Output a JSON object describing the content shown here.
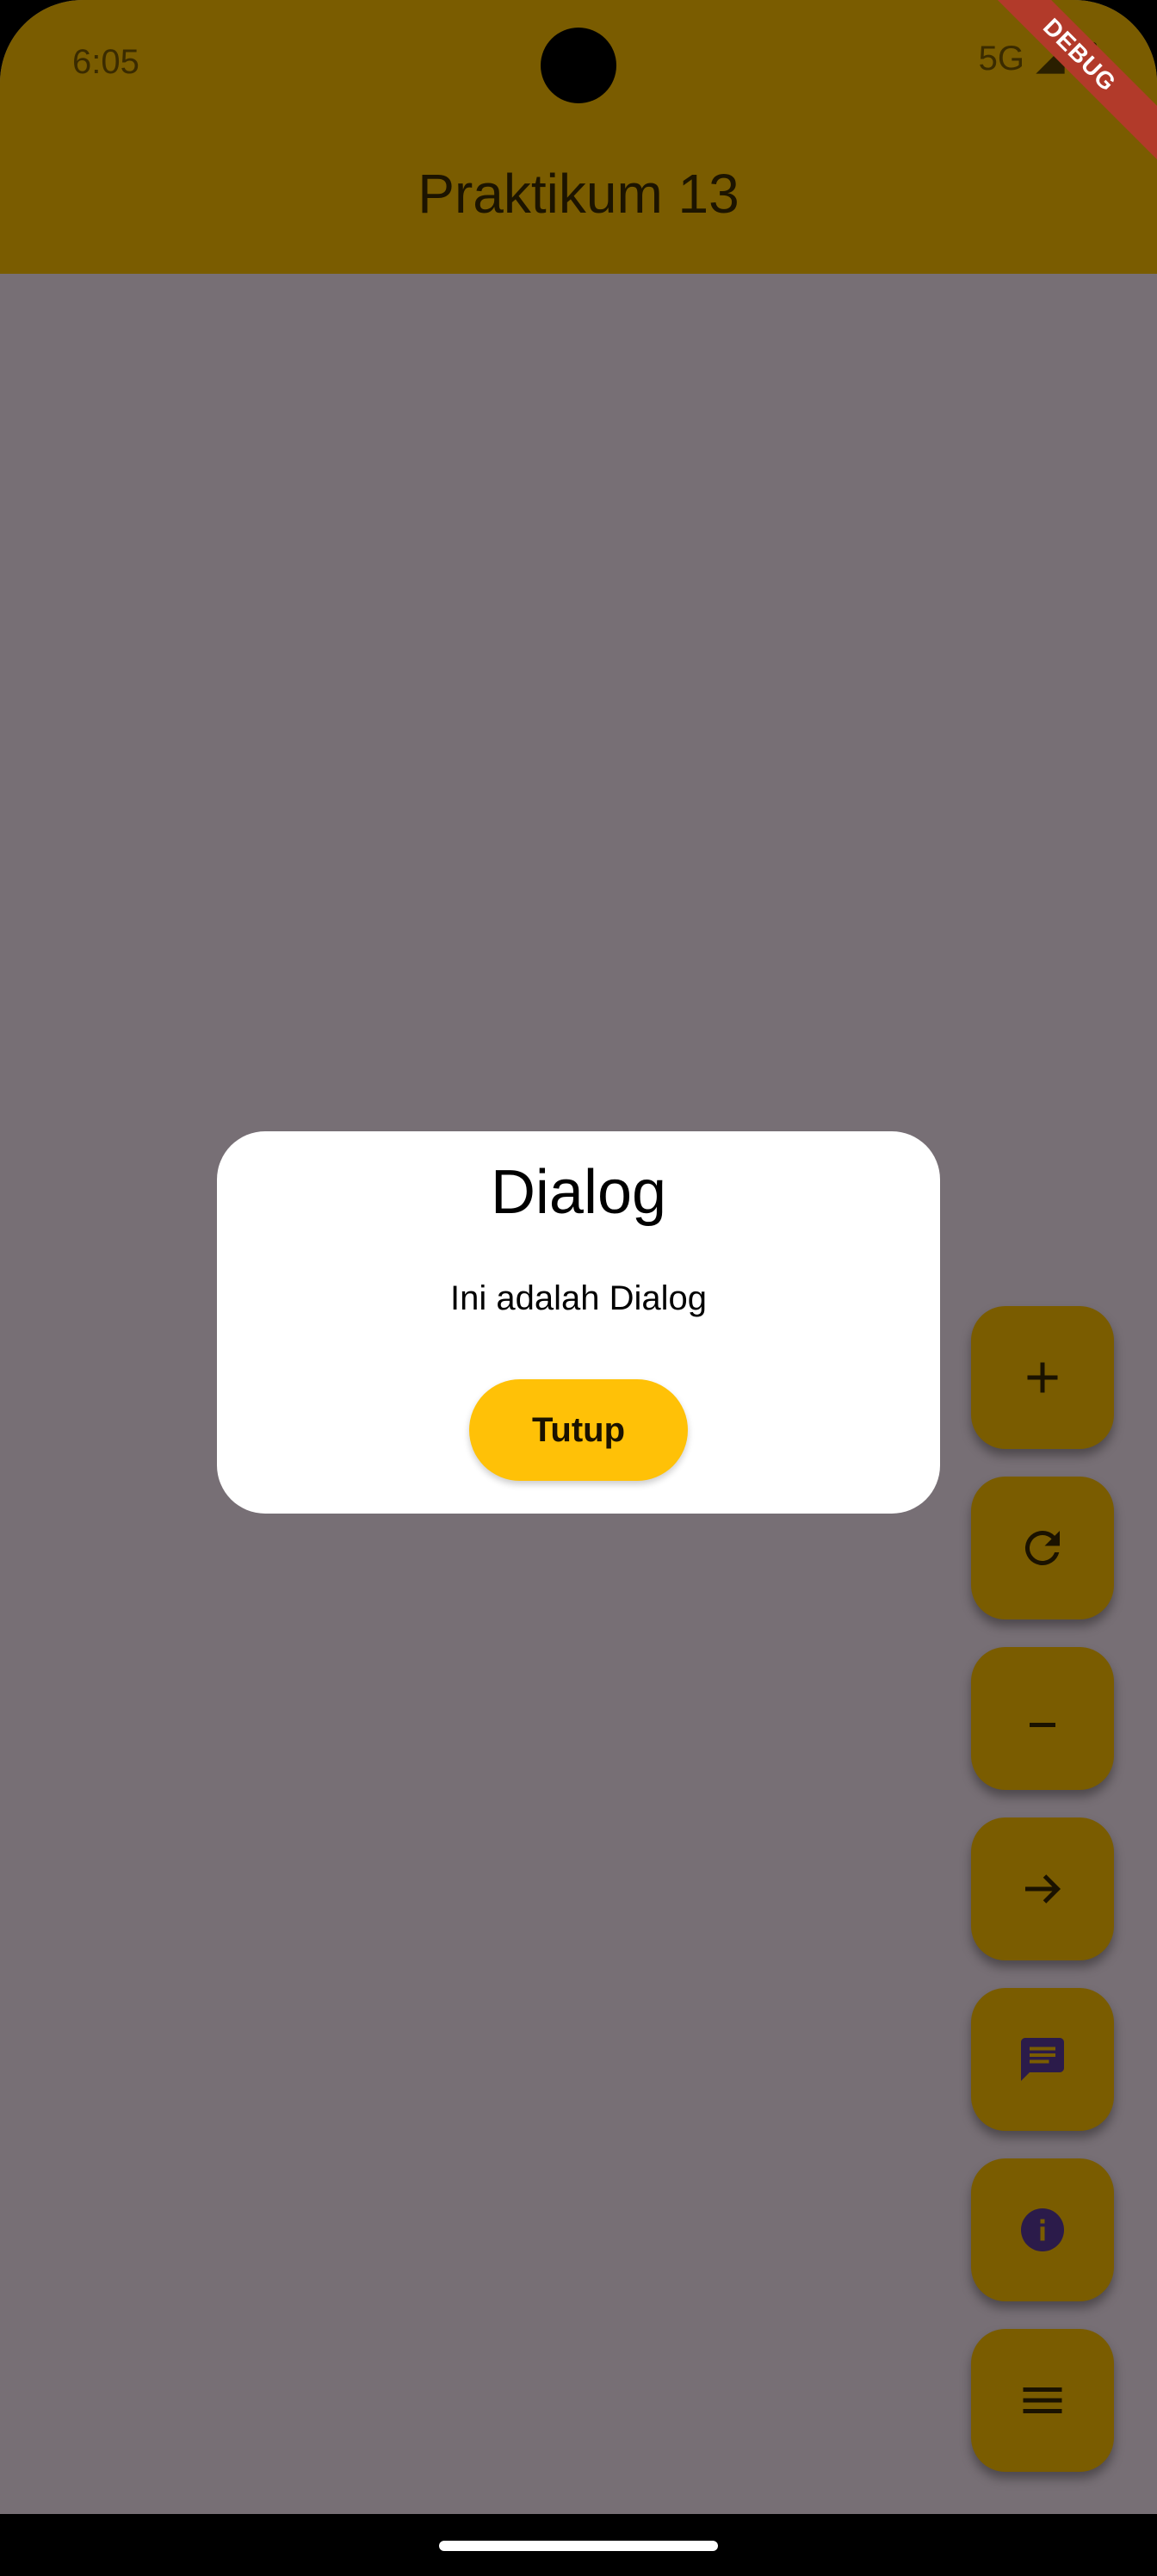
{
  "status_bar": {
    "time": "6:05",
    "network": "5G"
  },
  "debug_banner": "DEBUG",
  "app_bar": {
    "title": "Praktikum 13"
  },
  "dialog": {
    "title": "Dialog",
    "message": "Ini adalah Dialog",
    "close_label": "Tutup"
  },
  "fab_buttons": [
    {
      "icon": "add-icon"
    },
    {
      "icon": "refresh-icon"
    },
    {
      "icon": "remove-icon"
    },
    {
      "icon": "arrow-forward-icon"
    },
    {
      "icon": "message-icon"
    },
    {
      "icon": "info-icon"
    },
    {
      "icon": "menu-icon"
    }
  ],
  "colors": {
    "app_bar": "#7A5C00",
    "scrim_background": "#776F75",
    "dialog_button": "#FFC107",
    "debug_banner": "#B23A2A"
  }
}
